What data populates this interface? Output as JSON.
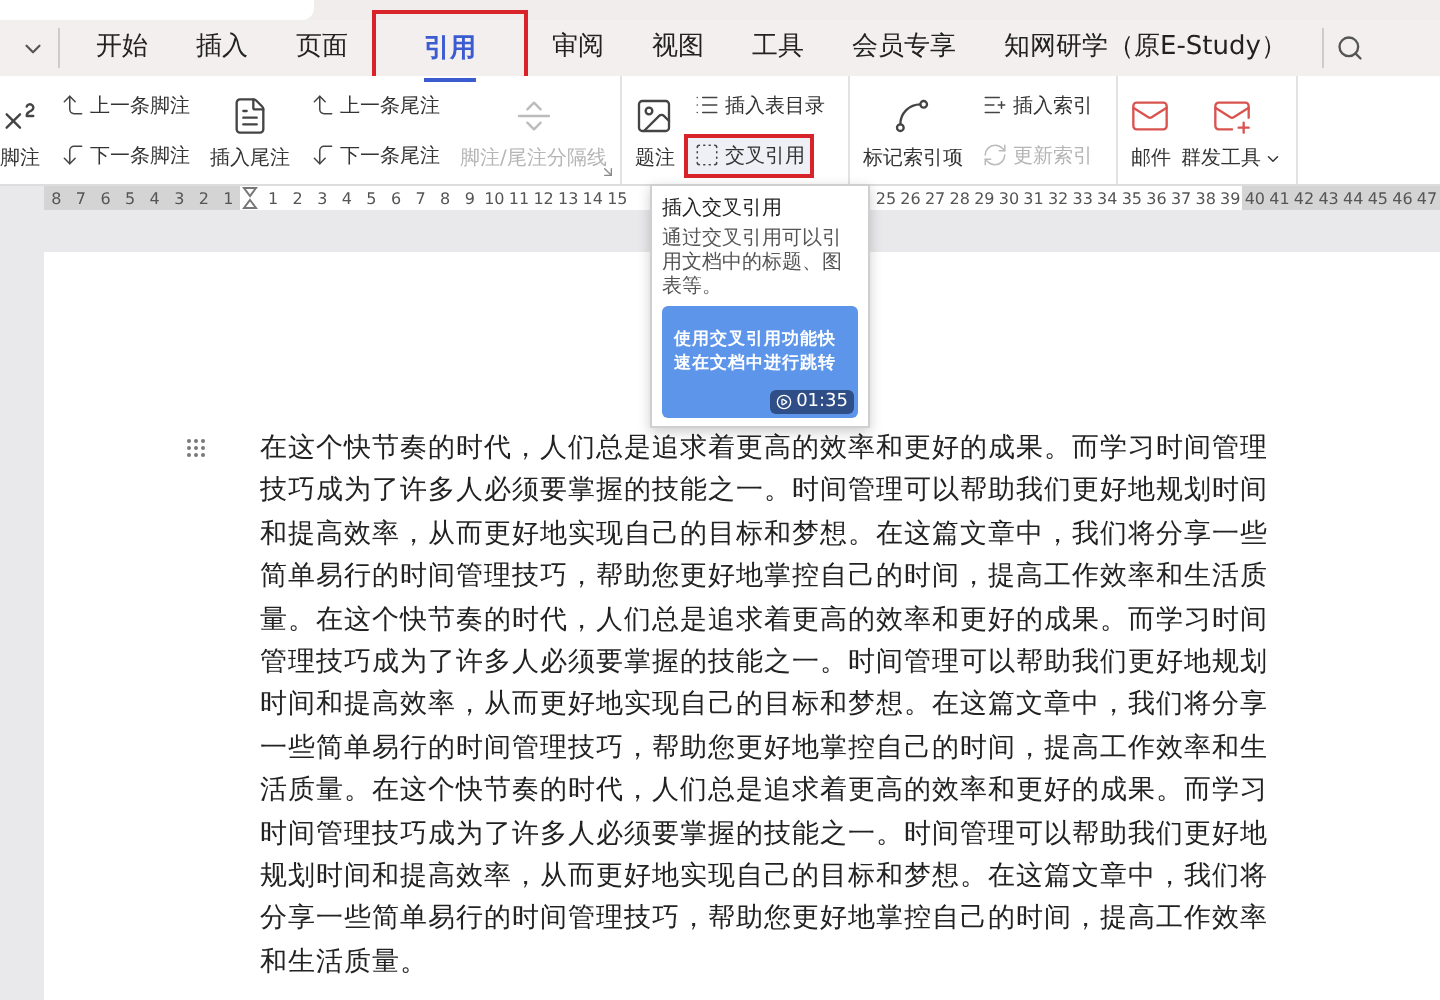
{
  "menu_tabs": [
    {
      "label": "开始",
      "selected": false,
      "highlighted": false
    },
    {
      "label": "插入",
      "selected": false,
      "highlighted": false
    },
    {
      "label": "页面",
      "selected": false,
      "highlighted": false
    },
    {
      "label": "引用",
      "selected": true,
      "highlighted": true
    },
    {
      "label": "审阅",
      "selected": false,
      "highlighted": false
    },
    {
      "label": "视图",
      "selected": false,
      "highlighted": false
    },
    {
      "label": "工具",
      "selected": false,
      "highlighted": false
    },
    {
      "label": "会员专享",
      "selected": false,
      "highlighted": false
    },
    {
      "label": "知网研学（原E-Study）",
      "selected": false,
      "highlighted": false
    }
  ],
  "ribbon": {
    "groups": [
      {
        "launcher": true,
        "columns": [
          [
            {
              "kind": "large",
              "label": "脚注",
              "disabled": false
            }
          ],
          [
            {
              "kind": "small",
              "label": "上一条脚注",
              "disabled": false,
              "highlighted": false
            },
            {
              "kind": "small",
              "label": "下一条脚注",
              "disabled": false,
              "highlighted": false
            }
          ],
          [
            {
              "kind": "large",
              "label": "插入尾注",
              "disabled": false
            }
          ],
          [
            {
              "kind": "small",
              "label": "上一条尾注",
              "disabled": false,
              "highlighted": false
            },
            {
              "kind": "small",
              "label": "下一条尾注",
              "disabled": false,
              "highlighted": false
            }
          ],
          [
            {
              "kind": "large",
              "label": "脚注/尾注分隔线",
              "disabled": true
            }
          ]
        ]
      },
      {
        "columns": [
          [
            {
              "kind": "large",
              "label": "题注",
              "disabled": false
            }
          ],
          [
            {
              "kind": "small",
              "label": "插入表目录",
              "disabled": false,
              "highlighted": false
            },
            {
              "kind": "small",
              "label": "交叉引用",
              "disabled": false,
              "highlighted": true
            }
          ]
        ]
      },
      {
        "columns": [
          [
            {
              "kind": "large",
              "label": "标记索引项",
              "disabled": false
            }
          ],
          [
            {
              "kind": "small",
              "label": "插入索引",
              "disabled": false,
              "highlighted": false
            },
            {
              "kind": "small",
              "label": "更新索引",
              "disabled": true,
              "highlighted": false
            }
          ]
        ]
      },
      {
        "columns": [
          [
            {
              "kind": "large",
              "label": "邮件",
              "disabled": false
            }
          ],
          [
            {
              "kind": "large",
              "label": "群发工具",
              "disabled": false,
              "dropdown": true
            }
          ]
        ]
      }
    ]
  },
  "ruler": {
    "segments": [
      {
        "shaded": true,
        "labels": [
          "8",
          "7",
          "6",
          "5",
          "4",
          "3",
          "2",
          "1"
        ]
      },
      {
        "shaded": false,
        "labels": [
          "1",
          "2",
          "3",
          "4",
          "5",
          "6",
          "7",
          "8",
          "9",
          "10",
          "11",
          "12",
          "13",
          "14",
          "15"
        ]
      },
      {
        "shaded": false,
        "labels": [
          "25",
          "26",
          "27",
          "28",
          "29",
          "30",
          "31",
          "32",
          "33",
          "34",
          "35",
          "36",
          "37",
          "38",
          "39"
        ]
      },
      {
        "shaded": true,
        "labels": [
          "40",
          "41",
          "42",
          "43",
          "44",
          "45",
          "46",
          "47"
        ]
      }
    ]
  },
  "tooltip": {
    "title": "插入交叉引用",
    "description": "通过交叉引用可以引用文档中的标题、图表等。",
    "video": {
      "caption": "使用交叉引用功能快速在文档中进行跳转",
      "duration": "01:35"
    }
  },
  "document": {
    "paragraph": "在这个快节奏的时代，人们总是追求着更高的效率和更好的成果。而学习时间管理技巧成为了许多人必须要掌握的技能之一。时间管理可以帮助我们更好地规划时间和提高效率，从而更好地实现自己的目标和梦想。在这篇文章中，我们将分享一些简单易行的时间管理技巧，帮助您更好地掌控自己的时间，提高工作效率和生活质量。在这个快节奏的时代，人们总是追求着更高的效率和更好的成果。而学习时间管理技巧成为了许多人必须要掌握的技能之一。时间管理可以帮助我们更好地规划时间和提高效率，从而更好地实现自己的目标和梦想。在这篇文章中，我们将分享一些简单易行的时间管理技巧，帮助您更好地掌控自己的时间，提高工作效率和生活质量。在这个快节奏的时代，人们总是追求着更高的效率和更好的成果。而学习时间管理技巧成为了许多人必须要掌握的技能之一。时间管理可以帮助我们更好地规划时间和提高效率，从而更好地实现自己的目标和梦想。在这篇文章中，我们将分享一些简单易行的时间管理技巧，帮助您更好地掌控自己的时间，提高工作效率和生活质量。"
  }
}
